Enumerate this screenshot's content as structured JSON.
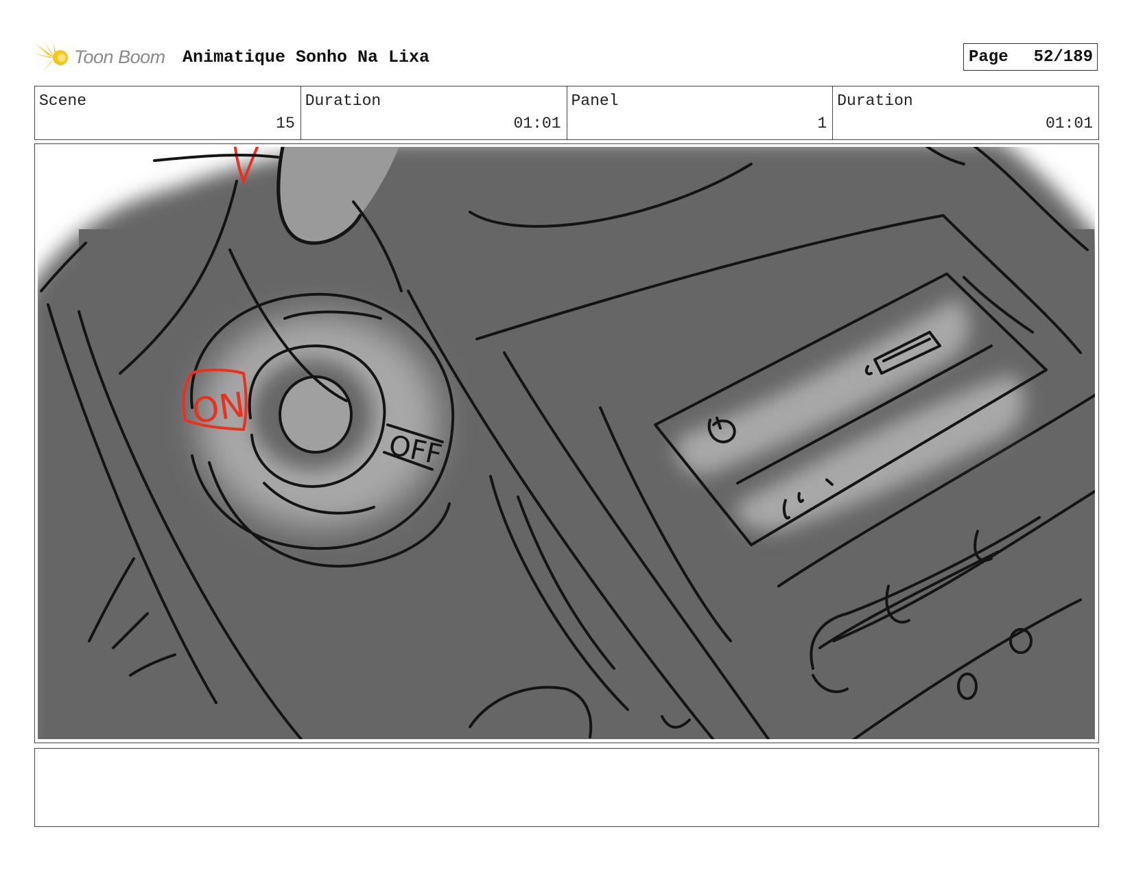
{
  "header": {
    "brand": "Toon Boom",
    "project_title": "Animatique Sonho Na Lixa",
    "page_label": "Page",
    "page_number": "52/189"
  },
  "info": {
    "scene_label": "Scene",
    "scene_value": "15",
    "scene_duration_label": "Duration",
    "scene_duration_value": "01:01",
    "panel_label": "Panel",
    "panel_value": "1",
    "panel_duration_label": "Duration",
    "panel_duration_value": "01:01"
  },
  "sketch": {
    "on_label": "ON",
    "off_label": "OFF",
    "colors": {
      "background_gray": "#666666",
      "highlight_gray": "#a8a8a8",
      "ink": "#141414",
      "accent_red": "#e8321e"
    }
  },
  "notes": {
    "text": ""
  }
}
